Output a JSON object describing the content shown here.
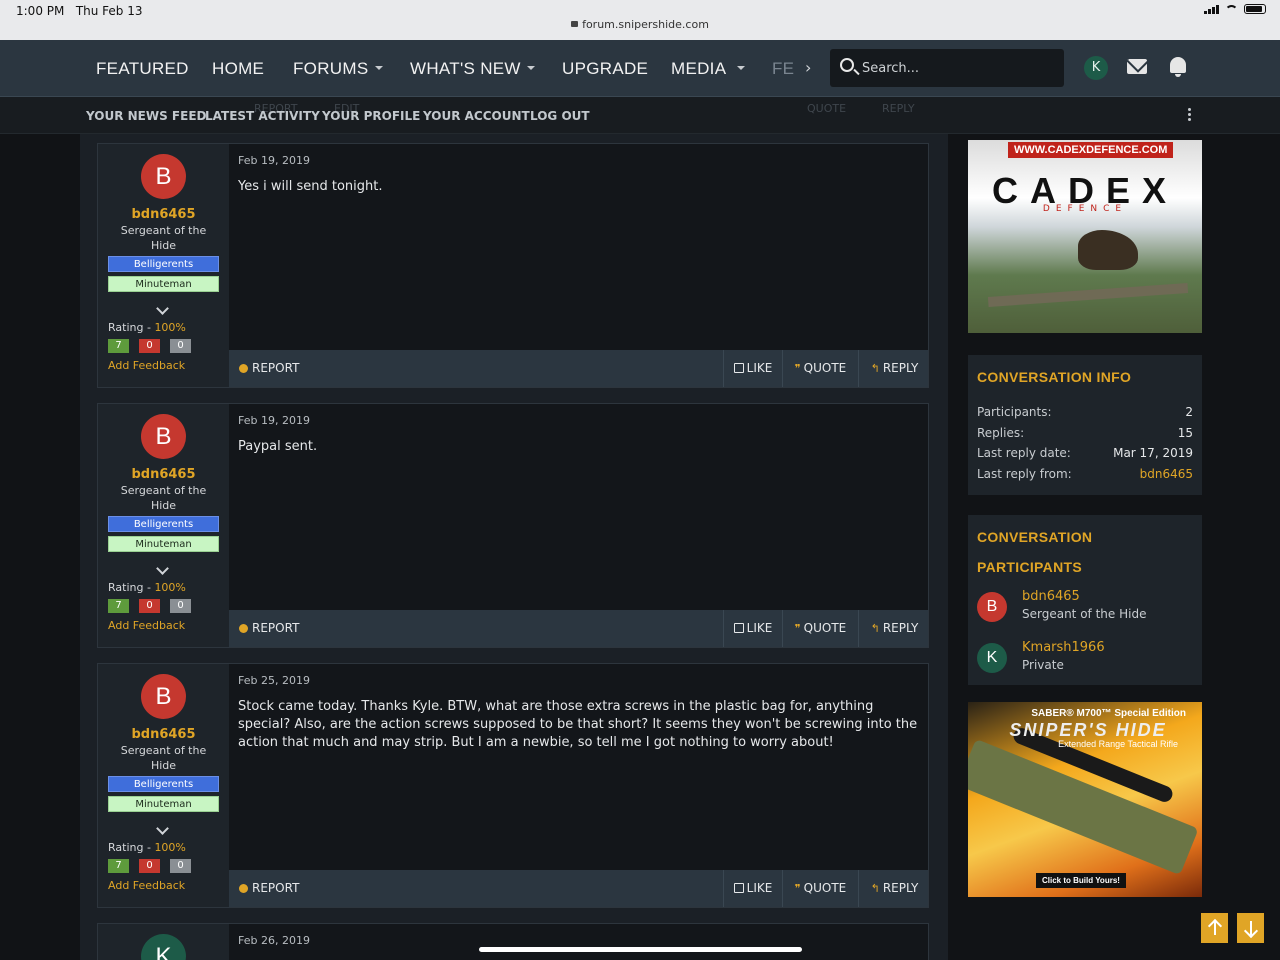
{
  "status": {
    "time": "1:00 PM",
    "date": "Thu Feb 13",
    "url": "forum.snipershide.com"
  },
  "nav": {
    "items": [
      "FEATURED",
      "HOME",
      "FORUMS",
      "WHAT'S NEW",
      "UPGRADE",
      "MEDIA",
      "FE"
    ],
    "search_placeholder": "Search...",
    "user_initial": "K"
  },
  "subnav": {
    "items": [
      "YOUR NEWS FEED",
      "LATEST ACTIVITY",
      "YOUR PROFILE",
      "YOUR ACCOUNT",
      "LOG OUT"
    ],
    "ghost": [
      "REPORT",
      "EDIT",
      "QUOTE",
      "REPLY"
    ]
  },
  "labels": {
    "report": "REPORT",
    "like": "LIKE",
    "quote": "QUOTE",
    "reply": "REPLY",
    "rating": "Rating",
    "add_feedback": "Add Feedback"
  },
  "posts": [
    {
      "initial": "B",
      "username": "bdn6465",
      "title": "Sergeant of the Hide",
      "badges": [
        "Belligerents",
        "Minuteman"
      ],
      "rating": "100%",
      "feedback": [
        "7",
        "0",
        "0"
      ],
      "date": "Feb 19, 2019",
      "message": "Yes i will send tonight."
    },
    {
      "initial": "B",
      "username": "bdn6465",
      "title": "Sergeant of the Hide",
      "badges": [
        "Belligerents",
        "Minuteman"
      ],
      "rating": "100%",
      "feedback": [
        "7",
        "0",
        "0"
      ],
      "date": "Feb 19, 2019",
      "message": "Paypal sent."
    },
    {
      "initial": "B",
      "username": "bdn6465",
      "title": "Sergeant of the Hide",
      "badges": [
        "Belligerents",
        "Minuteman"
      ],
      "rating": "100%",
      "feedback": [
        "7",
        "0",
        "0"
      ],
      "date": "Feb 25, 2019",
      "message": "Stock came today. Thanks Kyle. BTW, what are those extra screws in the plastic bag for, anything special? Also, are the action screws supposed to be that short? It seems they won't be screwing into the action that much and may strip. But I am a newbie, so tell me I got nothing to worry about!"
    },
    {
      "initial": "K",
      "date": "Feb 26, 2019"
    }
  ],
  "ad1": {
    "url": "WWW.CADEXDEFENCE.COM",
    "brand": "CADEX",
    "sub": "DEFENCE"
  },
  "conversation_info": {
    "heading": "CONVERSATION INFO",
    "rows": [
      {
        "label": "Participants:",
        "value": "2"
      },
      {
        "label": "Replies:",
        "value": "15"
      },
      {
        "label": "Last reply date:",
        "value": "Mar 17, 2019"
      },
      {
        "label": "Last reply from:",
        "value": "bdn6465"
      }
    ]
  },
  "participants": {
    "heading_line1": "CONVERSATION",
    "heading_line2": "PARTICIPANTS",
    "list": [
      {
        "initial": "B",
        "name": "bdn6465",
        "title": "Sergeant of the Hide",
        "color": "#c5382f"
      },
      {
        "initial": "K",
        "name": "Kmarsh1966",
        "title": "Private",
        "color": "#1d5b48"
      }
    ]
  },
  "ad2": {
    "line1": "SABER® M700™ Special Edition",
    "line2": "SNIPER'S HIDE",
    "line3": "Extended Range Tactical Rifle",
    "cta": "Click to Build Yours!"
  },
  "colors": {
    "accent": "#e0a526",
    "nav_bg": "#2b3640",
    "badge_blue": "#3f6edb",
    "badge_green": "#c8f5c3"
  }
}
